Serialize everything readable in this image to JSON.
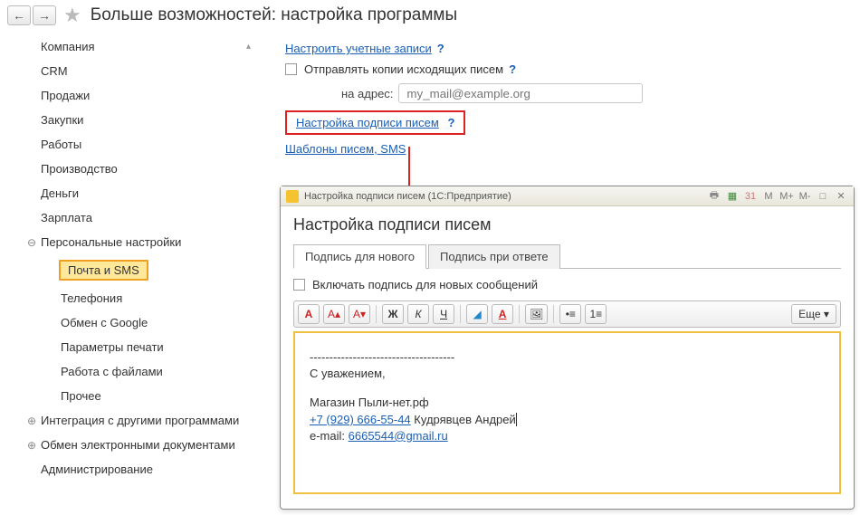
{
  "header": {
    "title": "Больше возможностей: настройка программы"
  },
  "sidebar": {
    "items": [
      {
        "label": "Компания",
        "exp": ""
      },
      {
        "label": "CRM",
        "exp": ""
      },
      {
        "label": "Продажи",
        "exp": ""
      },
      {
        "label": "Закупки",
        "exp": ""
      },
      {
        "label": "Работы",
        "exp": ""
      },
      {
        "label": "Производство",
        "exp": ""
      },
      {
        "label": "Деньги",
        "exp": ""
      },
      {
        "label": "Зарплата",
        "exp": ""
      },
      {
        "label": "Персональные настройки",
        "exp": "⊖"
      },
      {
        "label": "Почта и SMS",
        "exp": ""
      },
      {
        "label": "Телефония",
        "exp": ""
      },
      {
        "label": "Обмен с Google",
        "exp": ""
      },
      {
        "label": "Параметры печати",
        "exp": ""
      },
      {
        "label": "Работа с файлами",
        "exp": ""
      },
      {
        "label": "Прочее",
        "exp": ""
      },
      {
        "label": "Интеграция с другими программами",
        "exp": "⊕"
      },
      {
        "label": "Обмен электронными документами",
        "exp": "⊕"
      },
      {
        "label": "Администрирование",
        "exp": ""
      }
    ]
  },
  "main": {
    "configure_accounts": "Настроить учетные записи",
    "send_copies_label": "Отправлять копии исходящих писем",
    "to_address_label": "на адрес:",
    "address_placeholder": "my_mail@example.org",
    "signature_settings": "Настройка подписи писем",
    "templates": "Шаблоны писем, SMS",
    "hint": "?"
  },
  "dialog": {
    "window_title": "Настройка подписи писем  (1С:Предприятие)",
    "heading": "Настройка подписи писем",
    "tabs": [
      "Подпись для нового",
      "Подпись при ответе"
    ],
    "include_label": "Включать подпись для новых сообщений",
    "more": "Еще",
    "toolbar": {
      "font": "A",
      "font_big": "A▴",
      "font_small": "A▾",
      "bold": "Ж",
      "italic": "К",
      "underline": "Ч",
      "highlight": "◢",
      "color": "A",
      "insert": "🖼",
      "bullets": "•≡",
      "numbers": "1≡"
    },
    "signature": {
      "divider": "-------------------------------------",
      "greeting": "С уважением,",
      "company": "Магазин Пыли-нет.рф",
      "phone": "+7 (929) 666-55-44",
      "name": "Кудрявцев Андрей",
      "email_label": "e-mail:",
      "email": "6665544@gmail.ru"
    },
    "title_buttons": [
      "M",
      "M+",
      "M-"
    ]
  }
}
